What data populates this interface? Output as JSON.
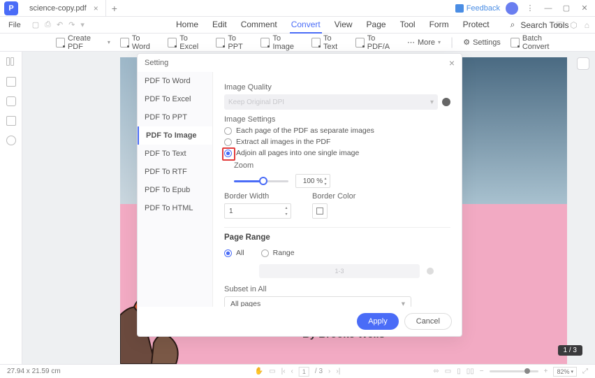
{
  "titlebar": {
    "tab_name": "science-copy.pdf",
    "feedback": "Feedback"
  },
  "menu": {
    "file": "File",
    "items": [
      "Home",
      "Edit",
      "Comment",
      "Convert",
      "View",
      "Page",
      "Tool",
      "Form",
      "Protect"
    ],
    "active_index": 3,
    "search_placeholder": "Search Tools"
  },
  "toolbar": {
    "create_pdf": "Create PDF",
    "to_word": "To Word",
    "to_excel": "To Excel",
    "to_ppt": "To PPT",
    "to_image": "To Image",
    "to_text": "To Text",
    "to_pdfa": "To PDF/A",
    "more": "More",
    "settings": "Settings",
    "batch": "Batch Convert"
  },
  "document": {
    "author_line": "By Brooke Wells",
    "page_indicator": "1 / 3"
  },
  "dialog": {
    "title": "Setting",
    "nav": [
      "PDF To Word",
      "PDF To Excel",
      "PDF To PPT",
      "PDF To Image",
      "PDF To Text",
      "PDF To RTF",
      "PDF To Epub",
      "PDF To HTML"
    ],
    "nav_selected": 3,
    "image_quality_label": "Image Quality",
    "quality_value": "Keep Original DPI",
    "image_settings_label": "Image Settings",
    "opt1": "Each page of the PDF as separate images",
    "opt2": "Extract all images in the PDF",
    "opt3": "Adjoin all pages into one single image",
    "zoom_label": "Zoom",
    "zoom_value": "100 %",
    "border_width_label": "Border Width",
    "border_width_value": "1",
    "border_color_label": "Border Color",
    "page_range_label": "Page Range",
    "pr_all": "All",
    "pr_range": "Range",
    "range_placeholder": "1-3",
    "subset_label": "Subset in All",
    "subset_value": "All pages",
    "apply": "Apply",
    "cancel": "Cancel"
  },
  "status": {
    "dimensions": "27.94 x 21.59 cm",
    "page": "1",
    "page_total": "/ 3",
    "zoom_pct": "82%"
  }
}
